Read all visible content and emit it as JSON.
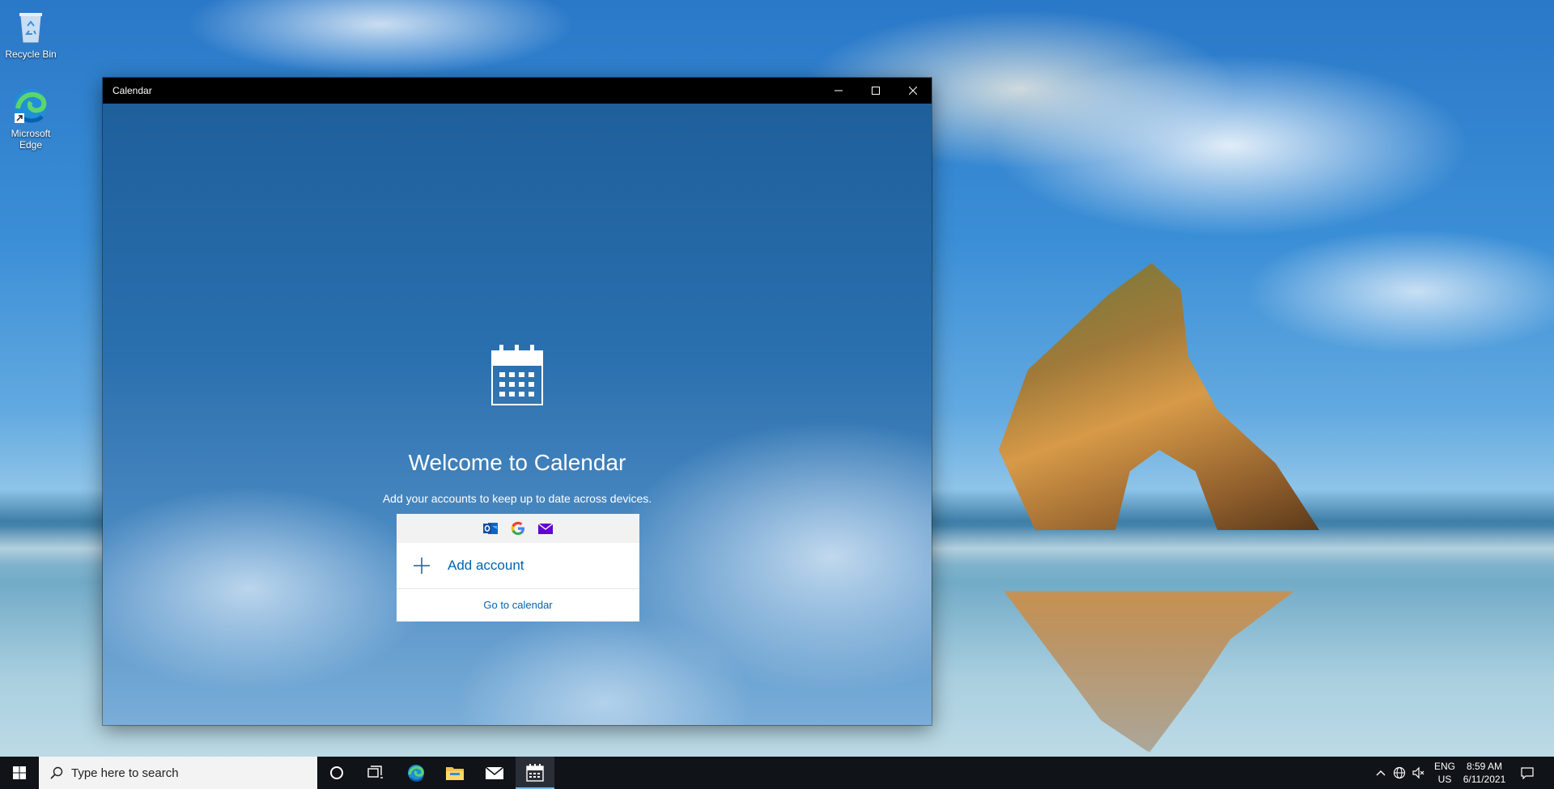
{
  "desktop": {
    "icons": [
      {
        "label": "Recycle Bin",
        "icon": "recycle-bin-icon"
      },
      {
        "label": "Microsoft Edge",
        "icon": "edge-icon"
      }
    ]
  },
  "window": {
    "title": "Calendar",
    "controls": {
      "minimize": "minimize-icon",
      "maximize": "maximize-icon",
      "close": "close-icon"
    },
    "welcome": {
      "heading": "Welcome to Calendar",
      "subtitle": "Add your accounts to keep up to date across devices.",
      "providers": [
        "outlook-icon",
        "google-icon",
        "yahoo-mail-icon"
      ],
      "add_account_label": "Add account",
      "goto_label": "Go to calendar"
    }
  },
  "taskbar": {
    "search_placeholder": "Type here to search",
    "apps": [
      "cortana-icon",
      "task-view-icon",
      "edge-icon",
      "file-explorer-icon",
      "mail-icon",
      "calendar-icon"
    ],
    "active_app": "calendar-icon",
    "tray": {
      "language_line1": "ENG",
      "language_line2": "US",
      "time": "8:59 AM",
      "date": "6/11/2021"
    }
  },
  "colors": {
    "accent": "#0063b1",
    "titlebar": "#000000",
    "taskbar": "#101318"
  }
}
